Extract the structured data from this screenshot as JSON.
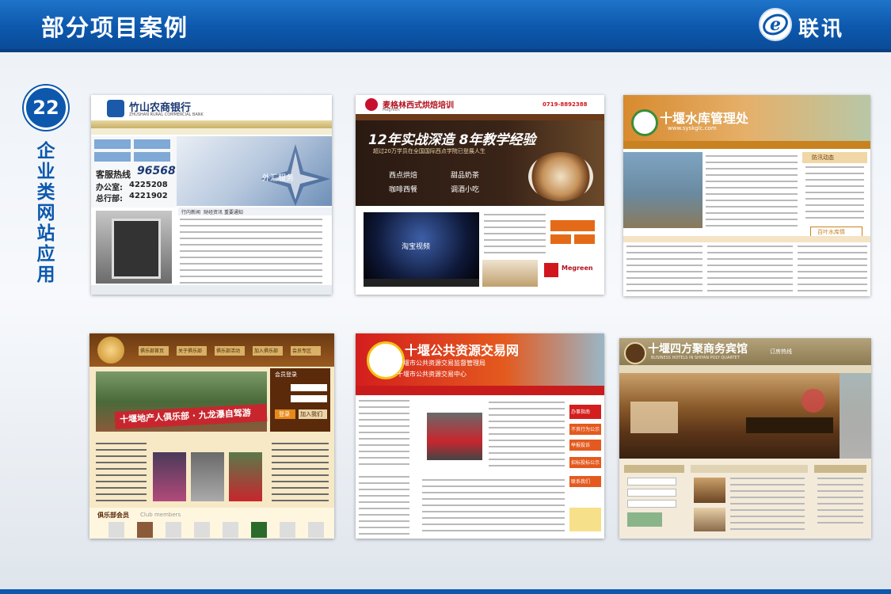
{
  "header": {
    "title": "部分项目案例",
    "logo_text": "联讯",
    "logo_mark": "e"
  },
  "badge": {
    "number": "22"
  },
  "side_label": "企业类网站应用",
  "thumbnails": {
    "t1": {
      "bank_name": "竹山农商银行",
      "bank_name_en": "ZHUSHAN RURAL COMMERCIAL BANK",
      "hotline_label": "客服热线",
      "hotline_number": "96568",
      "office_label": "办公室:",
      "office_number": "4225208",
      "general_label": "总行部:",
      "general_number": "4221902",
      "banner_text": "外汇服务",
      "tabs": [
        "行内新闻",
        "财经资讯",
        "重要通知"
      ]
    },
    "t2": {
      "brand": "麦格林西式烘焙培训",
      "brand_en": "Megreen",
      "banner_slogan": "12年实战深造 8年教学经验",
      "banner_sub": "超过20万学员在全国国际西点学院已登展人生",
      "courses": [
        "西点烘焙",
        "甜品奶茶",
        "咖啡西餐",
        "调酒小吃"
      ],
      "video_label": "淘宝视频",
      "phone": "0719-8892388"
    },
    "t3": {
      "site_name": "十堰水库管理处",
      "site_url": "www.syskglc.com",
      "box_title": "防汛动态",
      "link_text": "百叶水库情"
    },
    "t4": {
      "slogan": "十堰地产人俱乐部 · 九龙瀑自驾游",
      "login_title": "会员登录",
      "login_button": "登录",
      "join_button": "加入我们",
      "club_label": "俱乐部会员",
      "club_label_en": "Club members",
      "nav": [
        "俱乐部首页",
        "关于俱乐部",
        "俱乐部活动",
        "加入俱乐部",
        "会员专区"
      ]
    },
    "t5": {
      "site_name": "十堰公共资源交易网",
      "sub1": "十堰市公共资源交易监督管理局",
      "sub2": "十堰市公共资源交易中心",
      "menu": [
        "办事指南",
        "不良行为公示",
        "举报投诉",
        "招标投标公示",
        "联系我们"
      ]
    },
    "t6": {
      "hotel_name": "十堰四方聚商务宾馆",
      "hotel_name_en": "BUSINESS HOTELS IN SHIYAN POLY QUARTET",
      "hotline": "订房热线"
    }
  }
}
